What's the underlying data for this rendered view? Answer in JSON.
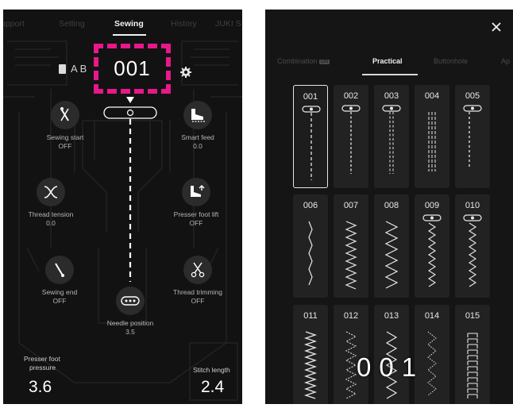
{
  "left_panel": {
    "nav": {
      "support": "upport",
      "setting": "Setting",
      "sewing": "Sewing",
      "history": "History",
      "juki": "JUKI S"
    },
    "pattern_letters": "A B",
    "pattern_number": "001",
    "controls": {
      "sewing_start": {
        "label": "Sewing start",
        "value": "OFF"
      },
      "smart_feed": {
        "label": "Smart feed",
        "value": "0.0"
      },
      "thread_tension": {
        "label": "Thread tension",
        "value": "0.0"
      },
      "presser_foot_lift": {
        "label": "Presser foot lift",
        "value": "OFF"
      },
      "sewing_end": {
        "label": "Sewing end",
        "value": "OFF"
      },
      "thread_trimming": {
        "label": "Thread trimming",
        "value": "OFF"
      },
      "needle_position": {
        "label": "Needle position",
        "value": "3.5"
      }
    },
    "presser_foot_pressure": {
      "label_line1": "Presser foot",
      "label_line2": "pressure",
      "value": "3.6"
    },
    "stitch_length": {
      "label": "Stitch length",
      "value": "2.4"
    }
  },
  "right_panel": {
    "tabs": {
      "combination": "Combination",
      "combination_badge": "ON",
      "practical": "Practical",
      "buttonhole": "Buttonhole",
      "ap": "Ap"
    },
    "patterns": [
      "001",
      "002",
      "003",
      "004",
      "005",
      "006",
      "007",
      "008",
      "009",
      "010",
      "011",
      "012",
      "013",
      "014",
      "015"
    ],
    "selected_pattern": "001",
    "counter": "001"
  },
  "colors": {
    "highlight_dashed": "#e8178a",
    "background": "#121212",
    "tile": "#222222"
  },
  "icons": [
    "book-icon",
    "gear-icon",
    "close-icon",
    "needle-icon",
    "foot-icon",
    "thread-tension-icon",
    "presser-lift-icon",
    "scissors-icon",
    "needle-position-icon"
  ]
}
